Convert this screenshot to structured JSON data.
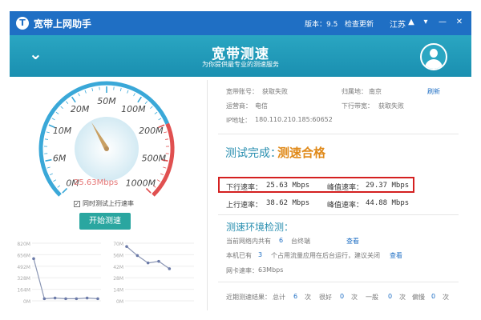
{
  "titlebar": {
    "app_title": "宽带上网助手",
    "version": "版本：9.5",
    "check_update": "检查更新",
    "region": "江苏",
    "icons": [
      "shirt-icon",
      "chevron-down-icon",
      "minimize-icon",
      "close-icon"
    ]
  },
  "header": {
    "title": "宽带测速",
    "subtitle": "为你提供最专业的测速服务"
  },
  "gauge": {
    "ticks": [
      "0M",
      "6M",
      "10M",
      "20M",
      "50M",
      "100M",
      "200M",
      "500M",
      "1000M"
    ],
    "reading": "25.63Mbps",
    "accent_blue": "#3aa8d8",
    "accent_red": "#e05050",
    "reading_fraction_of_scale": 0.39
  },
  "controls": {
    "sync_upload_label": "同时测试上行速率",
    "sync_upload_checked": true,
    "start_button": "开始测速"
  },
  "graphs": {
    "left_axis": [
      "820M",
      "656M",
      "492M",
      "328M",
      "164M",
      "0M"
    ],
    "left_values": [
      600,
      30,
      40,
      30,
      30,
      40,
      30
    ],
    "right_axis": [
      "70M",
      "56M",
      "42M",
      "28M",
      "14M",
      "0M"
    ],
    "right_values": [
      66,
      55,
      46,
      48,
      39
    ]
  },
  "info": {
    "account_label": "宽带账号：",
    "account_value": "获取失败",
    "location_label": "归属地：",
    "location_value": "南京",
    "refresh": "刷新",
    "isp_label": "运营商：",
    "isp_value": "电信",
    "downlink_label": "下行带宽：",
    "downlink_value": "获取失败",
    "ip_label": "IP地址：",
    "ip_value": "180.110.210.185:60652"
  },
  "result": {
    "prefix": "测试完成：",
    "verdict": "测速合格",
    "download_label": "下行速率：",
    "download_value": "25.63 Mbps",
    "download_peak_label": "峰值速率：",
    "download_peak_value": "29.37 Mbps",
    "upload_label": "上行速率：",
    "upload_value": "38.62 Mbps",
    "upload_peak_label": "峰值速率：",
    "upload_peak_value": "44.88 Mbps"
  },
  "environment": {
    "title": "测速环境检测：",
    "lan_text_a": "当前网络内共有",
    "lan_count": "6",
    "lan_text_b": "台终端",
    "lan_link": "查看",
    "bg_text_a": "本机已有",
    "bg_count": "3",
    "bg_text_b": "个占用流量应用在后台运行，建议关闭",
    "bg_link": "查看",
    "nic_label": "网卡速率：",
    "nic_value": "63Mbps"
  },
  "history": {
    "label": "近期测速结果：",
    "total_label": "总计",
    "total": "6",
    "very_good_label": "很好",
    "very_good": "0",
    "normal_label": "一般",
    "normal": "0",
    "poor_label": "偏慢",
    "poor": "0",
    "unit": "次"
  }
}
